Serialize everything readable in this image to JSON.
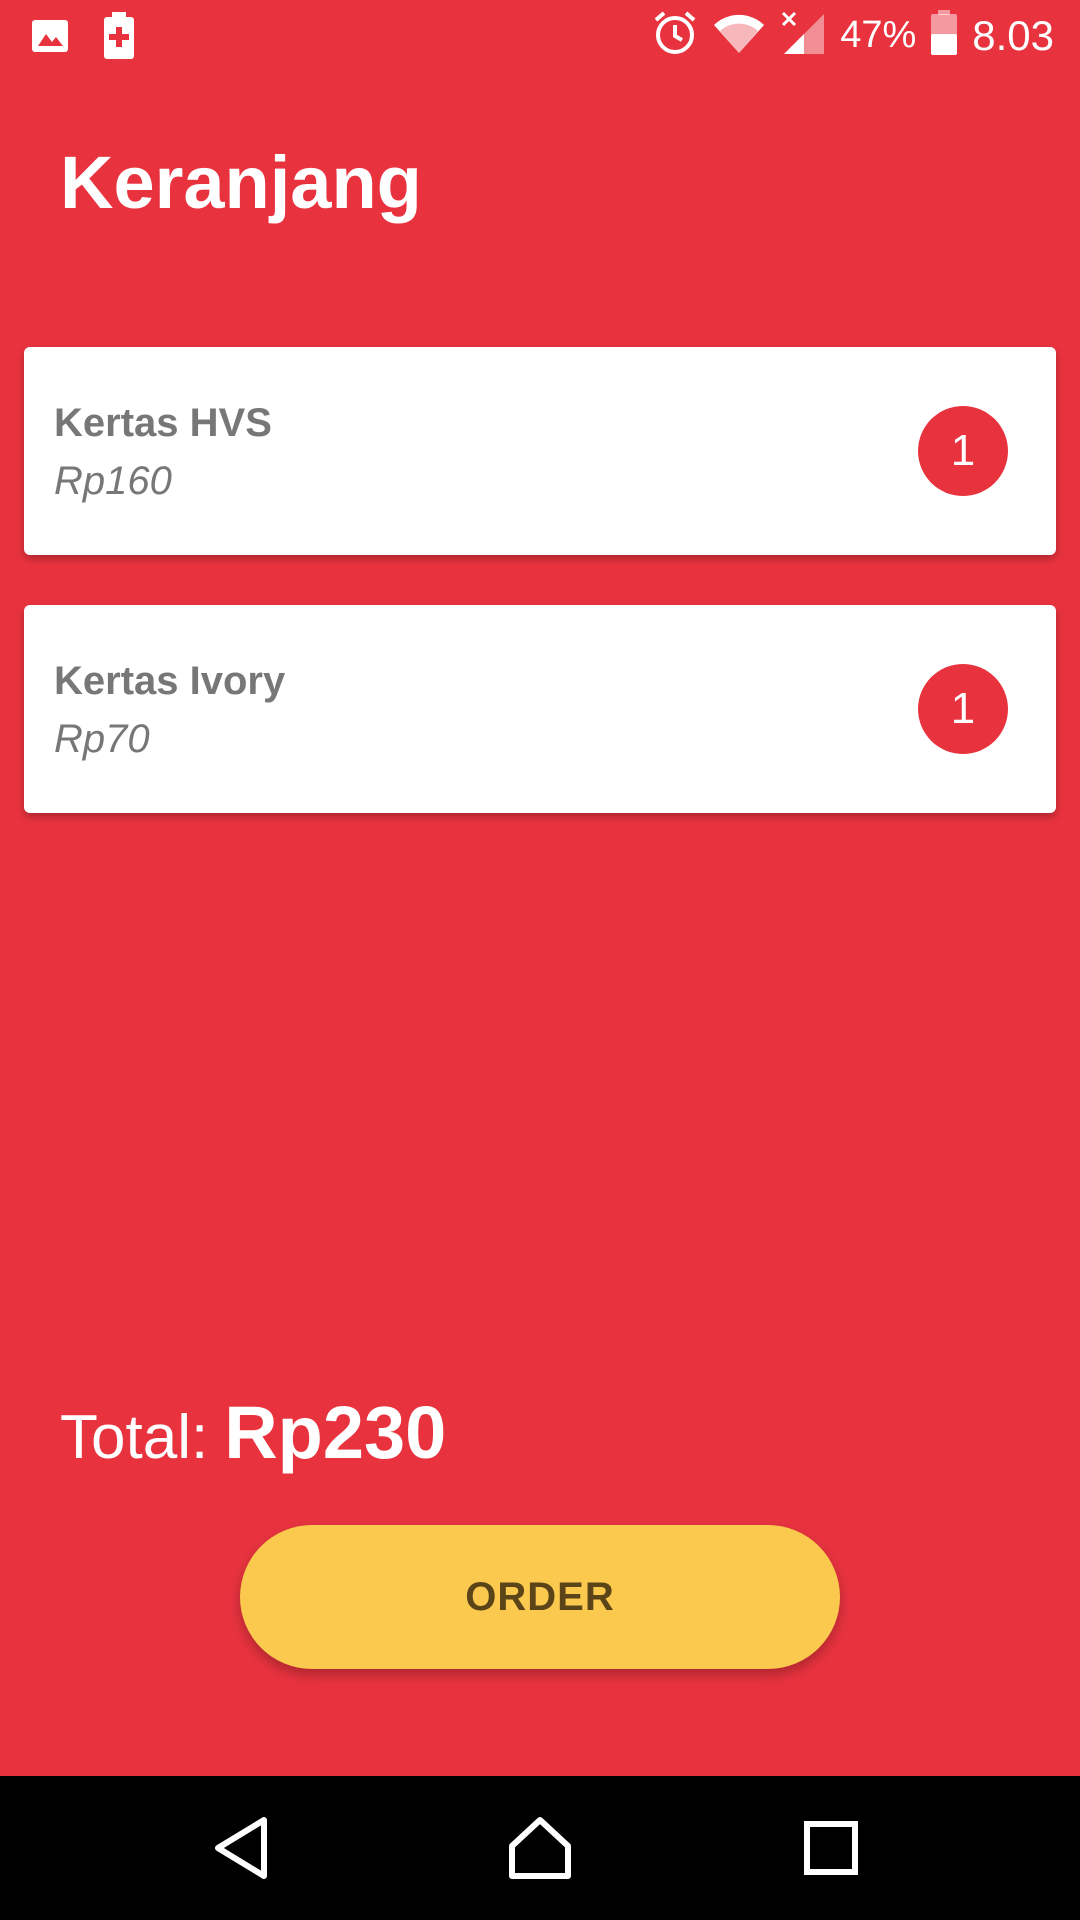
{
  "status_bar": {
    "battery_percent": "47%",
    "time": "8.03",
    "icons": [
      "image-icon",
      "battery-saver-icon",
      "alarm-icon",
      "wifi-icon",
      "signal-icon",
      "battery-icon"
    ]
  },
  "header": {
    "title": "Keranjang"
  },
  "cart": {
    "items": [
      {
        "name": "Kertas HVS",
        "price": "Rp160",
        "quantity": "1"
      },
      {
        "name": "Kertas Ivory",
        "price": "Rp70",
        "quantity": "1"
      }
    ]
  },
  "footer": {
    "total_label": "Total:",
    "total_value": "Rp230",
    "order_label": "ORDER"
  },
  "nav_bar": {
    "icons": [
      "back-icon",
      "home-icon",
      "recents-icon"
    ]
  },
  "colors": {
    "background": "#e8333f",
    "accent_button": "#fbc94d",
    "card": "#ffffff"
  }
}
